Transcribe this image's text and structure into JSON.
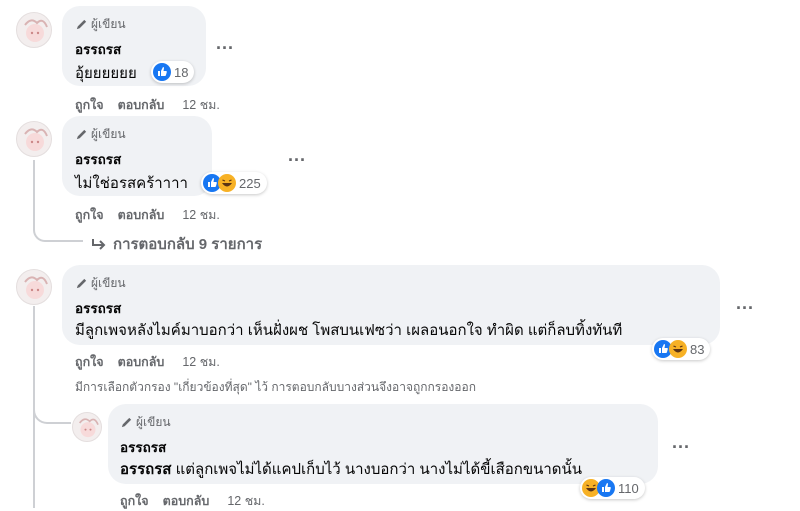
{
  "comments": [
    {
      "badge": "ผู้เขียน",
      "name": "อรรถรส",
      "text": "อุ้ยยยยยย",
      "reaction_count": "18",
      "like_label": "ถูกใจ",
      "reply_label": "ตอบกลับ",
      "time": "12 ชม.",
      "more": "..."
    },
    {
      "badge": "ผู้เขียน",
      "name": "อรรถรส",
      "text": "ไม่ใช่อรสคร้าาาา",
      "reaction_count": "225",
      "like_label": "ถูกใจ",
      "reply_label": "ตอบกลับ",
      "time": "12 ชม.",
      "more": "..."
    },
    {
      "badge": "ผู้เขียน",
      "name": "อรรถรส",
      "text": "มีลูกเพจหลังไมค์มาบอกว่า เห็นฝั่งผช โพสบนเฟซว่า เผลอนอกใจ ทำผิด แต่ก็ลบทิ้งทันที",
      "reaction_count": "83",
      "like_label": "ถูกใจ",
      "reply_label": "ตอบกลับ",
      "time": "12 ชม.",
      "more": "..."
    },
    {
      "badge": "ผู้เขียน",
      "name": "อรรถรส",
      "mention": "อรรถรส",
      "text": " แต่ลูกเพจไม่ได้แคปเก็บไว้ นางบอกว่า นางไม่ได้ขี้เสือกขนาดนั้น",
      "reaction_count": "110",
      "like_label": "ถูกใจ",
      "reply_label": "ตอบกลับ",
      "time": "12 ชม.",
      "more": "..."
    }
  ],
  "replies_link": "การตอบกลับ 9 รายการ",
  "filter_note": "มีการเลือกตัวกรอง \"เกี่ยวข้องที่สุด\" ไว้ การตอบกลับบางส่วนจึงอาจถูกกรองออก",
  "colors": {
    "bubble": "#f0f2f5",
    "like_blue": "#1877f2",
    "haha_yellow": "#f7b125",
    "secondary_text": "#65676b"
  }
}
